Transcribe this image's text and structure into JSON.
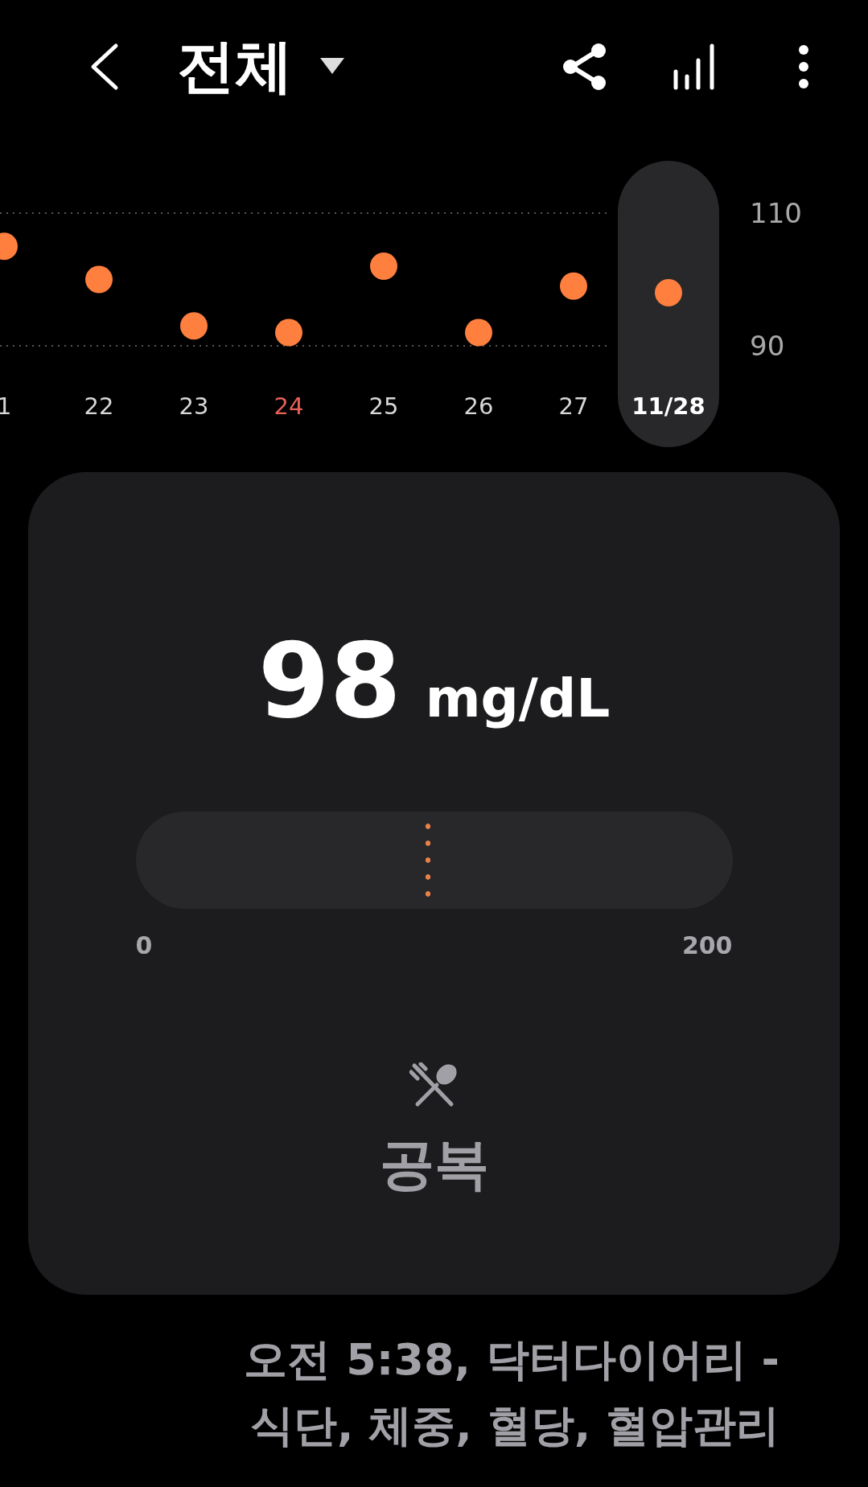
{
  "header": {
    "title": "전체"
  },
  "chart": {
    "chart_data": {
      "type": "scatter",
      "categories": [
        "1",
        "22",
        "23",
        "24",
        "25",
        "26",
        "27",
        "11/28"
      ],
      "series": [
        {
          "color": "#ff7f3f",
          "values": [
            105,
            100,
            93,
            92,
            102,
            92,
            99,
            98
          ]
        }
      ],
      "ylim": [
        90,
        110
      ],
      "yticks": [
        90,
        110
      ]
    },
    "columns": [
      {
        "selected": false,
        "color": "#d8d8d8"
      },
      {
        "selected": false,
        "color": "#d8d8d8"
      },
      {
        "selected": false,
        "color": "#d8d8d8"
      },
      {
        "selected": false,
        "color": "#e8605a"
      },
      {
        "selected": false,
        "color": "#d8d8d8"
      },
      {
        "selected": false,
        "color": "#d8d8d8"
      },
      {
        "selected": false,
        "color": "#d8d8d8"
      },
      {
        "selected": true,
        "color": "#ffffff"
      }
    ]
  },
  "reading": {
    "value": "98",
    "unit": "mg/dL",
    "level": 0.49,
    "scale_min": "0",
    "scale_max": "200",
    "meal_tag": "공복"
  },
  "caption": "오전 5:38, 닥터다이어리 - 식단, 체중, 혈당, 혈압관리"
}
